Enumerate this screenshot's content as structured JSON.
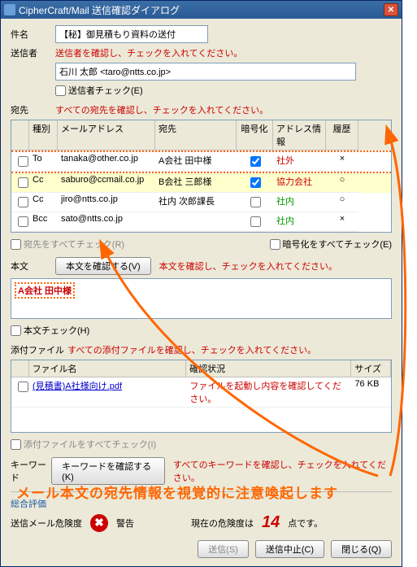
{
  "window": {
    "title": "CipherCraft/Mail  送信確認ダイアログ"
  },
  "subject": {
    "label": "件名",
    "value": "【秘】御見積もり資料の送付"
  },
  "sender": {
    "label": "送信者",
    "warning": "送信者を確認し、チェックを入れてください。",
    "value": "石川 太郎 <taro@ntts.co.jp>",
    "check_label": "送信者チェック(E)"
  },
  "dest": {
    "label": "宛先",
    "warning": "すべての宛先を確認し、チェックを入れてください。",
    "columns": {
      "type": "種別",
      "addr": "メールアドレス",
      "dest": "宛先",
      "enc": "暗号化",
      "info": "アドレス情報",
      "hist": "履歴"
    },
    "rows": [
      {
        "type": "To",
        "addr": "tanaka@other.co.jp",
        "dest": "A会社 田中様",
        "enc": true,
        "info": "社外",
        "info_cls": "txt-red",
        "hist": "×",
        "hi": "red"
      },
      {
        "type": "Cc",
        "addr": "saburo@ccmail.co.jp",
        "dest": "B会社 三郎様",
        "enc": true,
        "info": "協力会社",
        "info_cls": "txt-red",
        "hist": "○",
        "hi": "yel"
      },
      {
        "type": "Cc",
        "addr": "jiro@ntts.co.jp",
        "dest": "社内 次郎課長",
        "enc": false,
        "info": "社内",
        "info_cls": "txt-green",
        "hist": "○",
        "hi": ""
      },
      {
        "type": "Bcc",
        "addr": "sato@ntts.co.jp",
        "dest": "",
        "enc": false,
        "info": "社内",
        "info_cls": "txt-green",
        "hist": "×",
        "hi": ""
      }
    ],
    "check_all": "宛先をすべてチェック(R)",
    "enc_all": "暗号化をすべてチェック(E)"
  },
  "body": {
    "label": "本文",
    "confirm_btn": "本文を確認する(V)",
    "warning": "本文を確認し、チェックを入れてください。",
    "highlight": "A会社 田中様",
    "check_label": "本文チェック(H)"
  },
  "attach": {
    "label": "添付ファイル",
    "warning": "すべての添付ファイルを確認し、チェックを入れてください。",
    "columns": {
      "fname": "ファイル名",
      "stat": "確認状況",
      "size": "サイズ"
    },
    "rows": [
      {
        "fname": "(見積書)A社様向け.pdf",
        "stat": "ファイルを起動し内容を確認してください。",
        "size": "76 KB"
      }
    ],
    "check_all": "添付ファイルをすべてチェック(I)"
  },
  "keyword": {
    "label": "キーワード",
    "confirm_btn": "キーワードを確認する(K)",
    "warning": "すべてのキーワードを確認し、チェックを入れてください。"
  },
  "summary": {
    "title": "総合評価",
    "danger_label": "送信メール危険度",
    "severity": "警告",
    "current_label": "現在の危険度は",
    "value": "14",
    "unit": "点です。"
  },
  "buttons": {
    "send": "送信(S)",
    "abort": "送信中止(C)",
    "close": "閉じる(Q)"
  },
  "caption": "メール本文の宛先情報を視覚的に注意喚起します"
}
